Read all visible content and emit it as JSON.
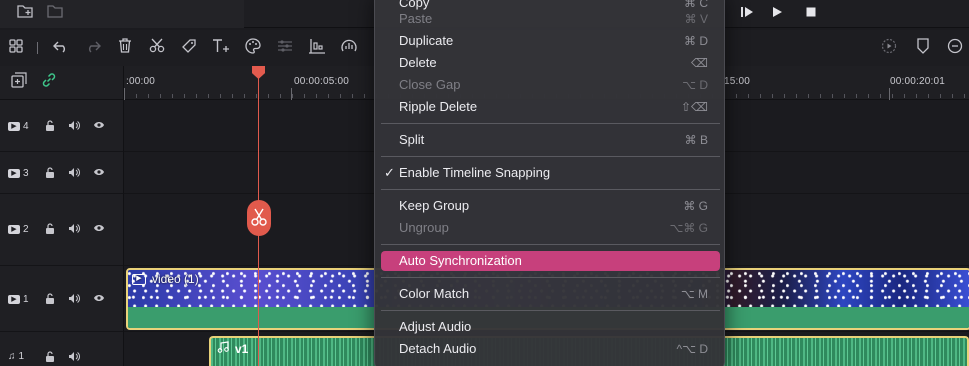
{
  "topbar": {
    "icons": [
      "new-folder-icon",
      "folder-icon"
    ],
    "play_controls": [
      "step-icon",
      "play-icon",
      "stop-icon"
    ]
  },
  "toolbar": {
    "icons": [
      "grid-icon",
      "undo-icon",
      "redo-icon",
      "delete-icon",
      "cut-icon",
      "tag-icon",
      "text-icon",
      "color-icon",
      "adjust-icon",
      "audio-mixer-icon",
      "speed-icon"
    ],
    "right_icons": [
      "render-icon",
      "shield-icon",
      "zoom-out-icon"
    ]
  },
  "timeline": {
    "ruler_labels": [
      ":00:00",
      "00:00:05:00",
      "15:00",
      "00:00:20:01"
    ],
    "tracks": [
      {
        "label": "4",
        "type": "video"
      },
      {
        "label": "3",
        "type": "video"
      },
      {
        "label": "2",
        "type": "video"
      },
      {
        "label": "1",
        "type": "video"
      },
      {
        "label": "1",
        "type": "audio"
      }
    ],
    "video_clip_title": "video (1)",
    "audio_clip_title": "v1"
  },
  "menu": {
    "items": [
      {
        "label": "Copy",
        "shortcut": "⌘ C",
        "disabled": false
      },
      {
        "label": "Paste",
        "shortcut": "⌘ V",
        "disabled": true
      },
      {
        "label": "Duplicate",
        "shortcut": "⌘ D",
        "disabled": false
      },
      {
        "label": "Delete",
        "shortcut": "⌫",
        "disabled": false
      },
      {
        "label": "Close Gap",
        "shortcut": "⌥ D",
        "disabled": true
      },
      {
        "label": "Ripple Delete",
        "shortcut": "⇧⌫",
        "disabled": false
      },
      {
        "label": "Split",
        "shortcut": "⌘ B",
        "disabled": false
      },
      {
        "label": "Enable Timeline Snapping",
        "shortcut": "",
        "disabled": false,
        "checked": true
      },
      {
        "label": "Keep Group",
        "shortcut": "⌘ G",
        "disabled": false
      },
      {
        "label": "Ungroup",
        "shortcut": "⌥⌘ G",
        "disabled": true
      },
      {
        "label": "Auto Synchronization",
        "shortcut": "",
        "disabled": false,
        "highlighted": true
      },
      {
        "label": "Color Match",
        "shortcut": "⌥ M",
        "disabled": false
      },
      {
        "label": "Adjust Audio",
        "shortcut": "",
        "disabled": false
      },
      {
        "label": "Detach Audio",
        "shortcut": "^⌥ D",
        "disabled": false
      }
    ]
  },
  "colors": {
    "accent_highlight": "#c7407c",
    "playhead": "#e35b4e",
    "clip_border": "#e9d27a",
    "audio_wave": "#3a9d6d"
  }
}
